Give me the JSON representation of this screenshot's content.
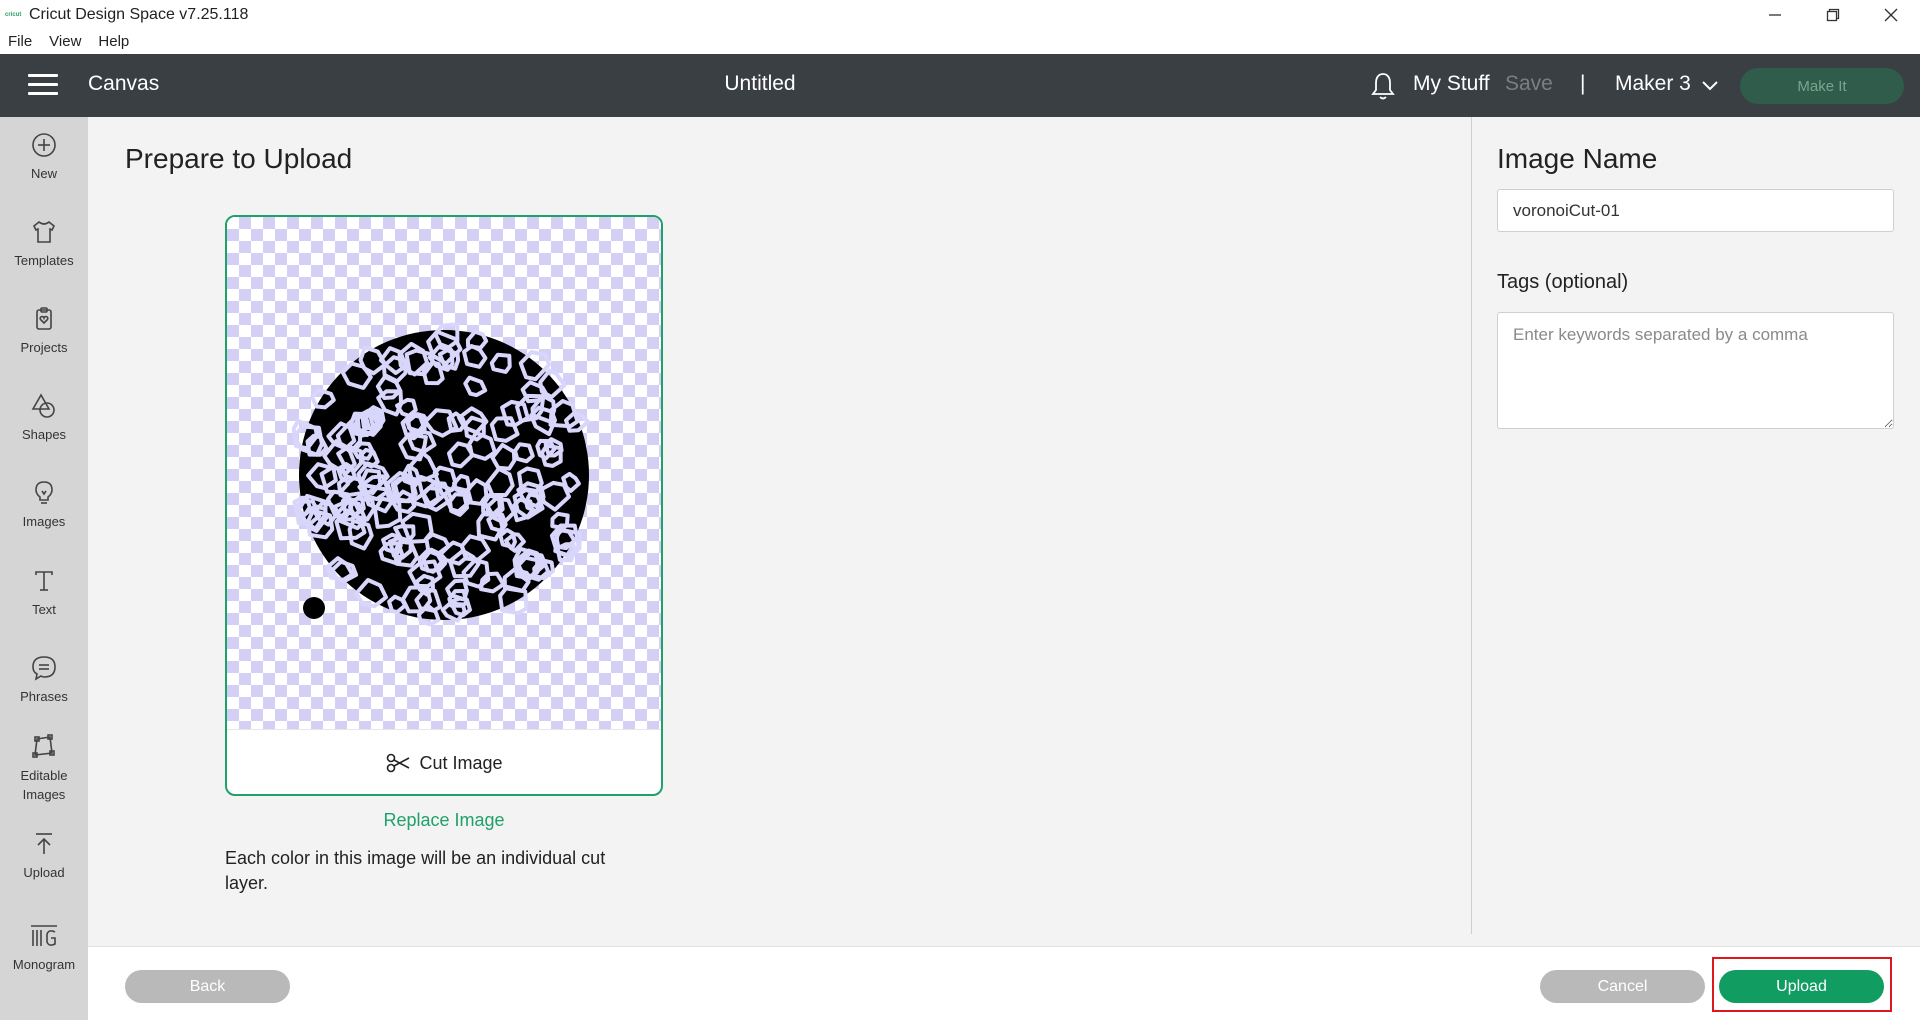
{
  "window": {
    "logo_text": "cricut",
    "title": "Cricut Design Space  v7.25.118"
  },
  "menu": {
    "items": [
      "File",
      "View",
      "Help"
    ]
  },
  "header": {
    "section": "Canvas",
    "document_title": "Untitled",
    "my_stuff": "My Stuff",
    "save": "Save",
    "separator": "|",
    "machine": "Maker 3",
    "make_it": "Make It"
  },
  "sidebar": {
    "items": [
      {
        "label": "New",
        "icon": "plus-circle-icon"
      },
      {
        "label": "Templates",
        "icon": "shirt-icon"
      },
      {
        "label": "Projects",
        "icon": "project-heart-icon"
      },
      {
        "label": "Shapes",
        "icon": "shapes-icon"
      },
      {
        "label": "Images",
        "icon": "lightbulb-icon"
      },
      {
        "label": "Text",
        "icon": "text-icon"
      },
      {
        "label": "Phrases",
        "icon": "speech-bubble-icon"
      },
      {
        "label": "Editable Images",
        "icon": "editable-images-icon"
      },
      {
        "label": "Upload",
        "icon": "upload-icon"
      },
      {
        "label": "Monogram",
        "icon": "monogram-icon"
      }
    ]
  },
  "main": {
    "title": "Prepare to Upload",
    "card_action": "Cut Image",
    "replace_link": "Replace Image",
    "info": "Each color in this image will be an individual cut layer."
  },
  "panel": {
    "image_name_label": "Image Name",
    "image_name_value": "voronoiCut-01",
    "tags_label": "Tags (optional)",
    "tags_placeholder": "Enter keywords separated by a comma"
  },
  "footer": {
    "back": "Back",
    "cancel": "Cancel",
    "upload": "Upload"
  },
  "colors": {
    "header_bg": "#3a3f44",
    "accent_green": "#20a06a",
    "upload_button": "#119c62",
    "highlight_red": "#e0161e"
  }
}
